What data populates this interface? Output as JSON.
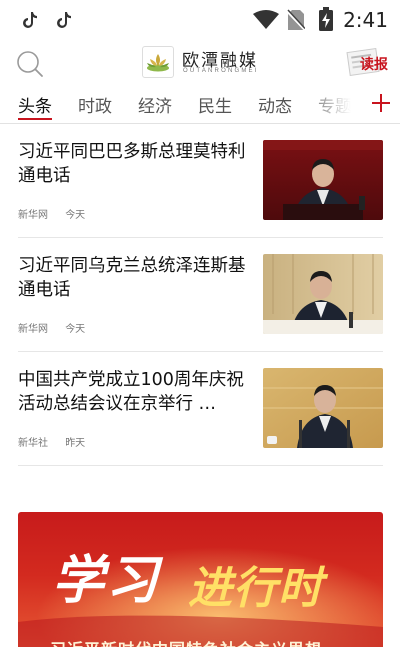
{
  "status_bar": {
    "time": "2:41",
    "left_icons": [
      "tiktok-icon",
      "tiktok-icon"
    ],
    "right_icons": [
      "wifi-icon",
      "no-sim-icon",
      "battery-charging-icon"
    ]
  },
  "header": {
    "brand_name": "欧潭融媒",
    "brand_sub": "OUTANRONGMEI",
    "read_label": "读报",
    "search_icon": "search-icon"
  },
  "tabs": [
    {
      "label": "头条",
      "active": true
    },
    {
      "label": "时政",
      "active": false
    },
    {
      "label": "经济",
      "active": false
    },
    {
      "label": "民生",
      "active": false
    },
    {
      "label": "动态",
      "active": false
    },
    {
      "label": "专题",
      "active": false
    }
  ],
  "accent_color": "#c8141e",
  "news": [
    {
      "title": "习近平同巴巴多斯总理莫特利通电话",
      "source": "新华网",
      "time": "今天"
    },
    {
      "title": "习近平同乌克兰总统泽连斯基通电话",
      "source": "新华网",
      "time": "今天"
    },
    {
      "title": "中国共产党成立100周年庆祝活动总结会议在京举行 …",
      "source": "新华社",
      "time": "昨天"
    }
  ],
  "banner": {
    "title_part1": "学习",
    "title_part2": "进行时",
    "subtitle": "习近平新时代中国特色社会主义思想"
  }
}
